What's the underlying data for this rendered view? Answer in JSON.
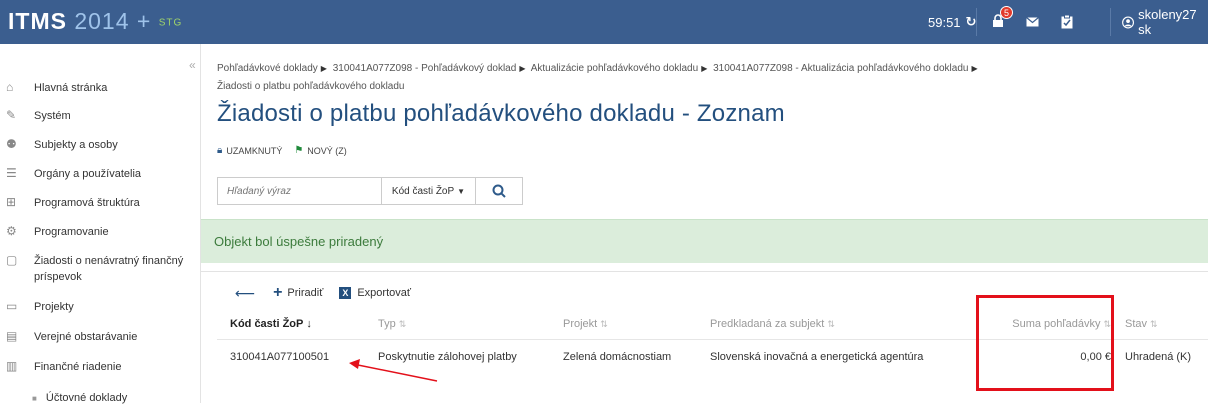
{
  "topbar": {
    "logo_letters": "ITMS",
    "logo_digits": "2014",
    "logo_plus": "+",
    "logo_env": "STG",
    "timer": "59:51",
    "notification_count": "5",
    "username": "skoleny27 sk"
  },
  "sidebar": {
    "items": [
      {
        "label": "Hlavná stránka",
        "icon": "home-icon"
      },
      {
        "label": "Systém",
        "icon": "wrench-icon"
      },
      {
        "label": "Subjekty a osoby",
        "icon": "people-icon"
      },
      {
        "label": "Orgány a používatelia",
        "icon": "users-icon"
      },
      {
        "label": "Programová štruktúra",
        "icon": "structure-icon"
      },
      {
        "label": "Programovanie",
        "icon": "cog-icon"
      },
      {
        "label": "Žiadosti o nenávratný finančný príspevok",
        "icon": "document-icon"
      },
      {
        "label": "Projekty",
        "icon": "monitor-icon"
      },
      {
        "label": "Verejné obstarávanie",
        "icon": "cart-icon"
      },
      {
        "label": "Finančné riadenie",
        "icon": "finance-icon"
      }
    ],
    "sub_item": "Účtovné doklady"
  },
  "breadcrumb": {
    "items": [
      "Pohľadávkové doklady",
      "310041A077Z098 - Pohľadávkový doklad",
      "Aktualizácie pohľadávkového dokladu",
      "310041A077Z098 - Aktualizácia pohľadávkového dokladu"
    ],
    "last": "Žiadosti o platbu pohľadávkového dokladu"
  },
  "page_title": "Žiadosti o platbu pohľadávkového dokladu - Zoznam",
  "status": {
    "locked": "UZAMKNUTÝ",
    "new": "NOVÝ (Z)"
  },
  "search": {
    "placeholder": "Hľadaný výraz",
    "dropdown_value": "Kód časti ŽoP"
  },
  "alert": "Objekt bol úspešne priradený",
  "actions": {
    "assign": "Priradiť",
    "export": "Exportovať"
  },
  "table": {
    "headers": [
      "Kód časti ŽoP",
      "Typ",
      "Projekt",
      "Predkladaná za subjekt",
      "Suma pohľadávky",
      "Stav"
    ],
    "rows": [
      [
        "310041A077100501",
        "Poskytnutie zálohovej platby",
        "Zelená domácnostiam",
        "Slovenská inovačná a energetická agentúra",
        "0,00 €",
        "Uhradená (K)"
      ]
    ]
  },
  "colors": {
    "topbar": "#3b5e8f",
    "title": "#234f7e",
    "alert_bg": "#dbeddb",
    "highlight": "#e3101a"
  }
}
